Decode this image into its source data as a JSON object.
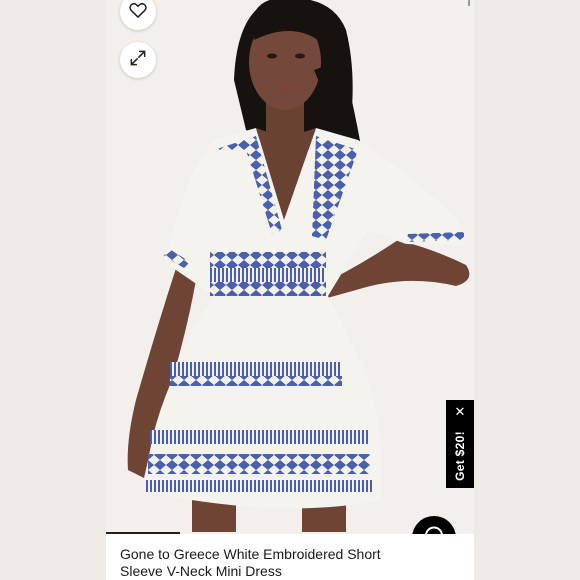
{
  "product": {
    "title": "Gone to Greece White Embroidered Short Sleeve V-Neck Mini Dress"
  },
  "actions": {
    "favorite_icon": "heart-icon",
    "expand_icon": "expand-arrows-icon"
  },
  "promo": {
    "label": "Get $20!",
    "close_symbol": "✕"
  },
  "chat": {
    "icon": "chat-bubble-icon"
  },
  "colors": {
    "embroidery": "#4a5fae",
    "dress": "#f4f3ee",
    "background": "#eeeae6",
    "promo_bg": "#000000"
  }
}
